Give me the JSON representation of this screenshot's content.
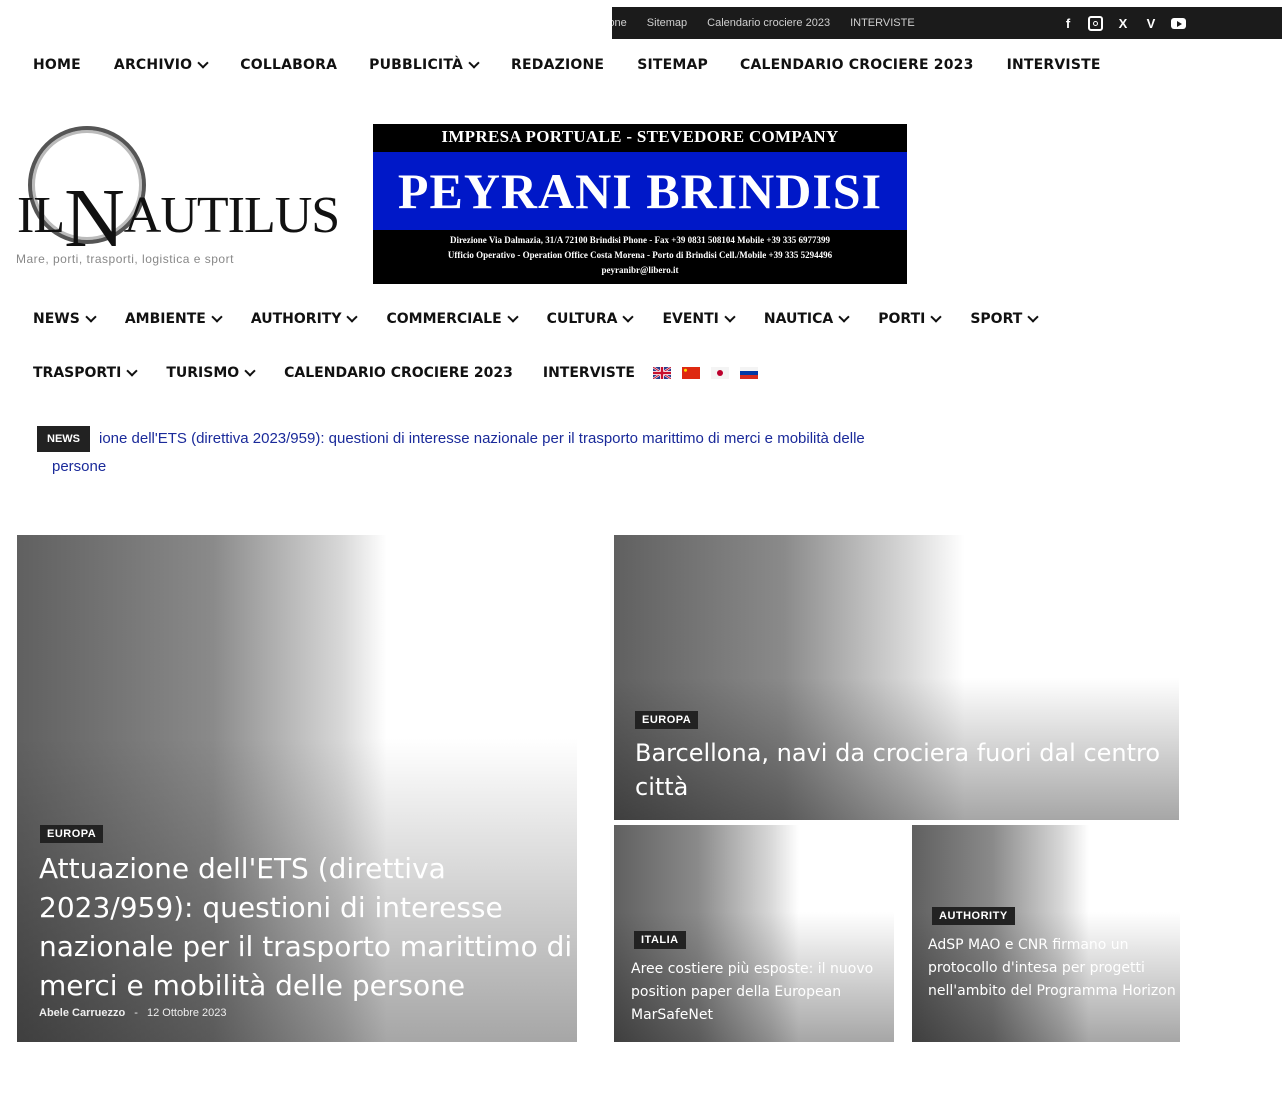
{
  "topbar": {
    "links": [
      "ione",
      "Sitemap",
      "Calendario crociere 2023",
      "INTERVISTE"
    ],
    "social": [
      "facebook-icon",
      "instagram-icon",
      "x-icon",
      "vimeo-icon",
      "youtube-icon"
    ]
  },
  "nav_top": [
    {
      "label": "HOME",
      "dropdown": false
    },
    {
      "label": "ARCHIVIO",
      "dropdown": true
    },
    {
      "label": "COLLABORA",
      "dropdown": false
    },
    {
      "label": "PUBBLICITÀ",
      "dropdown": true
    },
    {
      "label": "REDAZIONE",
      "dropdown": false
    },
    {
      "label": "SITEMAP",
      "dropdown": false
    },
    {
      "label": "CALENDARIO CROCIERE 2023",
      "dropdown": false
    },
    {
      "label": "INTERVISTE",
      "dropdown": false
    }
  ],
  "logo": {
    "il": "IL",
    "n": "N",
    "rest": "AUTILUS",
    "tagline": "Mare, porti, trasporti, logistica e sport"
  },
  "banner": {
    "line1": "IMPRESA PORTUALE - STEVEDORE COMPANY",
    "line2": "PEYRANI BRINDISI",
    "line3": "Direzione Via Dalmazia, 31/A 72100 Brindisi Phone - Fax +39 0831 508104 Mobile +39 335 6977399",
    "line4": "Ufficio Operativo - Operation Office Costa Morena - Porto di Brindisi Cell./Mobile +39 335 5294496",
    "line5": "peyranibr@libero.it"
  },
  "nav_main_row1": [
    {
      "label": "NEWS"
    },
    {
      "label": "AMBIENTE"
    },
    {
      "label": "AUTHORITY"
    },
    {
      "label": "COMMERCIALE"
    },
    {
      "label": "CULTURA"
    },
    {
      "label": "EVENTI"
    },
    {
      "label": "NAUTICA"
    },
    {
      "label": "PORTI"
    },
    {
      "label": "SPORT"
    }
  ],
  "nav_main_row2": [
    {
      "label": "TRASPORTI",
      "dropdown": true
    },
    {
      "label": "TURISMO",
      "dropdown": true
    },
    {
      "label": "CALENDARIO CROCIERE 2023",
      "dropdown": false
    },
    {
      "label": "INTERVISTE",
      "dropdown": false
    }
  ],
  "flags": [
    "english-flag-icon",
    "chinese-flag-icon",
    "japanese-flag-icon",
    "russian-flag-icon"
  ],
  "ticker": {
    "label": "NEWS",
    "line1": "ione dell'ETS (direttiva 2023/959): questioni di interesse nazionale per il trasporto marittimo di merci e mobilità delle",
    "line2": "persone"
  },
  "cards": {
    "main": {
      "tag": "EUROPA",
      "title": "Attuazione dell'ETS (direttiva 2023/959): questioni di interesse nazionale per il trasporto marittimo di merci e mobilità delle persone",
      "author": "Abele Carruezzo",
      "date": "12 Ottobre 2023"
    },
    "top_right": {
      "tag": "EUROPA",
      "title": "Barcellona, navi da crociera fuori dal centro città"
    },
    "bottom_left": {
      "tag": "ITALIA",
      "title": "Aree costiere più esposte: il nuovo position paper della European MarSafeNet"
    },
    "bottom_right": {
      "tag": "AUTHORITY",
      "title": "AdSP MAO e CNR firmano un protocollo d'intesa per progetti nell'ambito del Programma Horizon"
    }
  }
}
